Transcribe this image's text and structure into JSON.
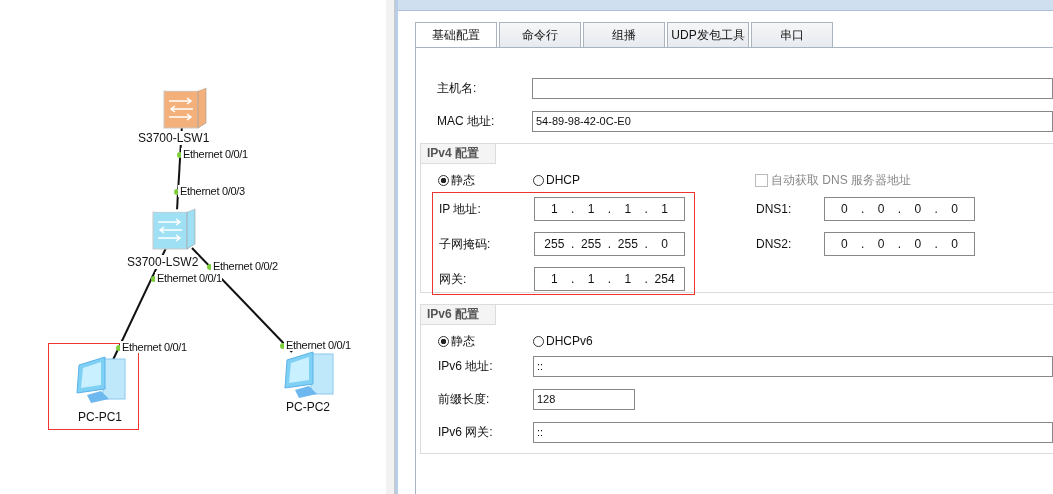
{
  "topology": {
    "devices": [
      {
        "kind": "switch",
        "name": "S3700-LSW1",
        "color": "#f4b07a",
        "selected": false
      },
      {
        "kind": "switch",
        "name": "S3700-LSW2",
        "color": "#9fe0f5",
        "selected": false
      },
      {
        "kind": "pc",
        "name": "PC-PC1",
        "selected": true
      },
      {
        "kind": "pc",
        "name": "PC-PC2",
        "selected": false
      }
    ],
    "ports": [
      "Ethernet 0/0/1",
      "Ethernet 0/0/3",
      "Ethernet 0/0/2",
      "Ethernet 0/0/1",
      "Ethernet 0/0/1",
      "Ethernet 0/0/1"
    ]
  },
  "tabs": [
    {
      "label": "基础配置",
      "selected": true
    },
    {
      "label": "命令行",
      "selected": false
    },
    {
      "label": "组播",
      "selected": false
    },
    {
      "label": "UDP发包工具",
      "selected": false
    },
    {
      "label": "串口",
      "selected": false
    }
  ],
  "basic": [
    {
      "label": "主机名:"
    },
    {
      "label": "MAC 地址:",
      "value": "54-89-98-42-0C-E0"
    }
  ],
  "ipv4": {
    "title": "IPv4 配置",
    "radios": [
      {
        "label": "静态",
        "selected": true
      },
      {
        "label": "DHCP",
        "selected": false
      }
    ],
    "dns_auto": {
      "label": "自动获取 DNS 服务器地址",
      "checked": false,
      "disabled": true
    },
    "separator": ".",
    "highlighted": true,
    "fields": [
      {
        "label": "IP 地址:",
        "octets": [
          "1",
          "1",
          "1",
          "1"
        ]
      },
      {
        "label": "子网掩码:",
        "octets": [
          "255",
          "255",
          "255",
          "0"
        ]
      },
      {
        "label": "网关:",
        "octets": [
          "1",
          "1",
          "1",
          "254"
        ]
      }
    ],
    "dns": [
      {
        "label": "DNS1:",
        "octets": [
          "0",
          "0",
          "0",
          "0"
        ]
      },
      {
        "label": "DNS2:",
        "octets": [
          "0",
          "0",
          "0",
          "0"
        ]
      }
    ]
  },
  "ipv6": {
    "title": "IPv6 配置",
    "radios": [
      {
        "label": "静态",
        "selected": true
      },
      {
        "label": "DHCPv6",
        "selected": false
      }
    ],
    "fields": [
      {
        "label": "IPv6 地址:",
        "value": "::",
        "kind": "wide"
      },
      {
        "label": "前缀长度:",
        "value": "128",
        "kind": "short"
      },
      {
        "label": "IPv6 网关:",
        "value": "::",
        "kind": "wide"
      }
    ]
  }
}
